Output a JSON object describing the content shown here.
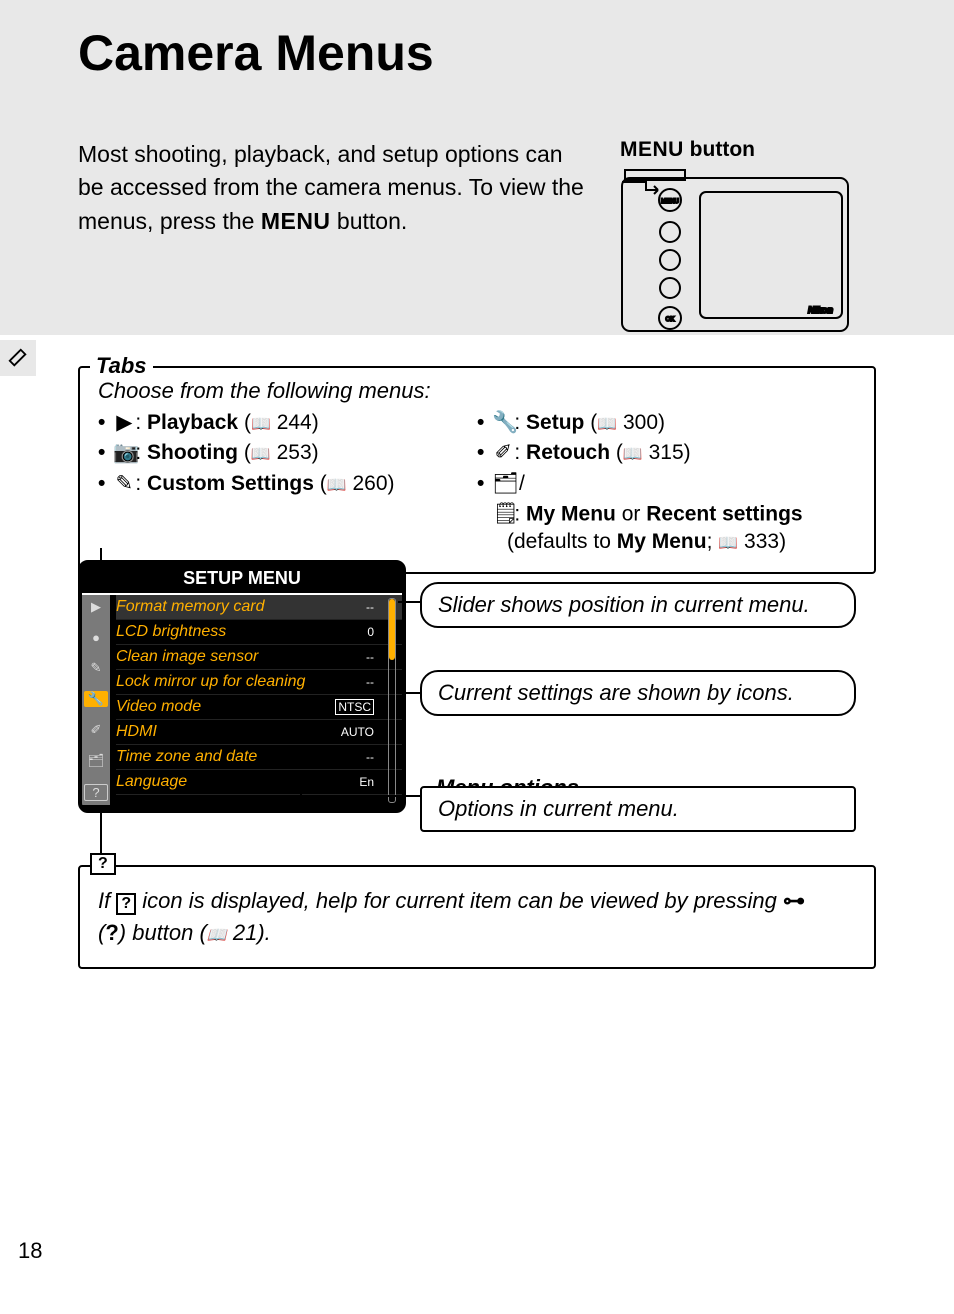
{
  "title": "Camera Menus",
  "intro": {
    "text_pre": "Most shooting, playback, and setup options can be accessed from the camera menus.  To view the menus, press the ",
    "menu_word": "MENU",
    "text_post": " button."
  },
  "caption": {
    "menu_word": "MENU",
    "label": " button"
  },
  "tabs": {
    "label": "Tabs",
    "intro": "Choose from the following menus:",
    "left": [
      {
        "icon": "▶",
        "name": "Playback",
        "page": "244"
      },
      {
        "icon": "📷",
        "name": "Shooting",
        "page": "253"
      },
      {
        "icon": "✎",
        "name": "Custom Settings",
        "page": "260"
      }
    ],
    "right": [
      {
        "icon": "🔧",
        "name": "Setup",
        "page": "300"
      },
      {
        "icon": "✐",
        "name": "Retouch",
        "page": "315"
      }
    ],
    "mymenu": {
      "icon": "🗂/🗒",
      "name1": "My Menu",
      "or": " or ",
      "name2": "Recent settings",
      "defaults_pre": "(defaults to ",
      "defaults_bold": "My Menu",
      "defaults_sep": "; ",
      "page": "333",
      "defaults_close": ")"
    }
  },
  "setup": {
    "title": "SETUP MENU",
    "rows": [
      {
        "label": "Format memory card",
        "val": "--"
      },
      {
        "label": "LCD brightness",
        "val": "0"
      },
      {
        "label": "Clean image sensor",
        "val": "--"
      },
      {
        "label": "Lock mirror up for cleaning",
        "val": "--"
      },
      {
        "label": "Video mode",
        "val": "NTSC"
      },
      {
        "label": "HDMI",
        "val": "AUTO"
      },
      {
        "label": "Time zone and date",
        "val": "--"
      },
      {
        "label": "Language",
        "val": "En"
      }
    ]
  },
  "callouts": {
    "slider": "Slider shows position in current menu.",
    "icons": "Current settings are shown by icons.",
    "menu_options_label": "Menu options",
    "menu_options_text": "Options in current menu."
  },
  "help": {
    "pre": "If ",
    "mid": " icon is displayed, help for current item can be viewed by pressing ",
    "key": "🔑",
    "paren_open": "(",
    "q": "?",
    "paren_mid": ") button (",
    "page": "21",
    "paren_close": ")."
  },
  "pageNumber": "18",
  "book_glyph": "📖"
}
